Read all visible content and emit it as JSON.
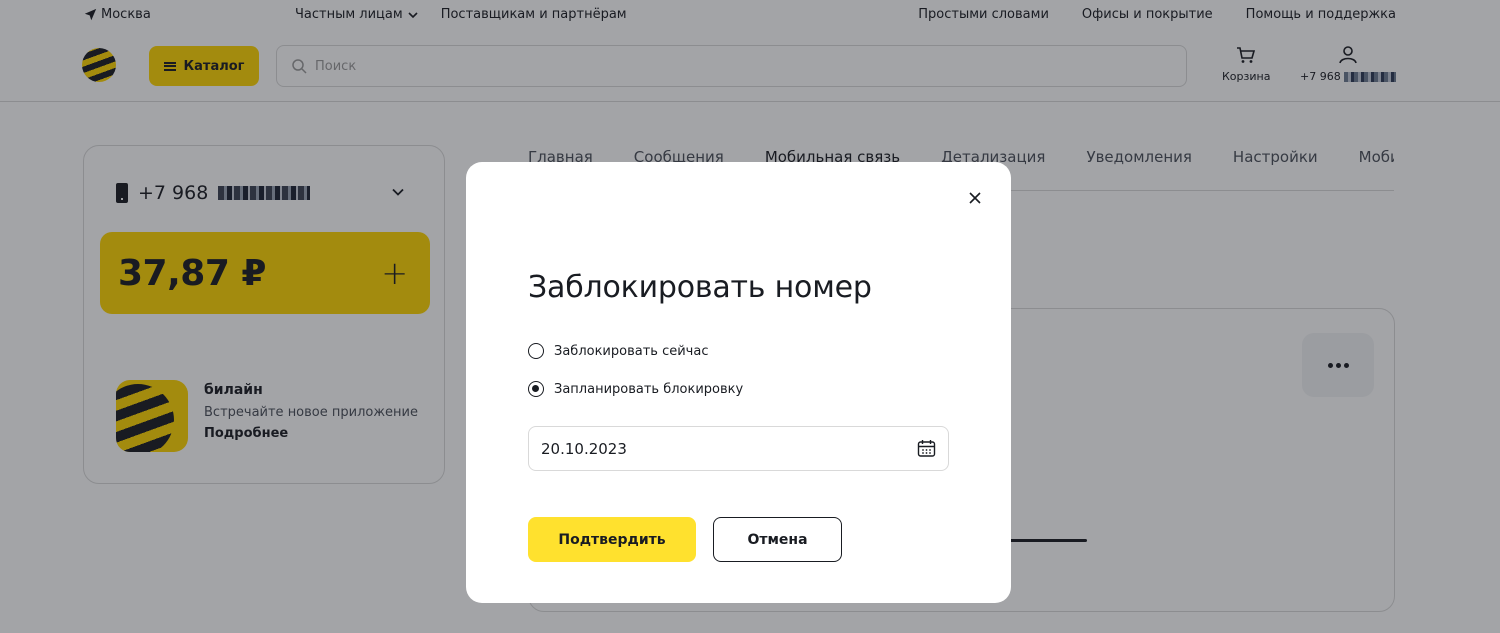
{
  "topbar": {
    "city": "Москва",
    "nav_left": [
      "Частным лицам",
      "Поставщикам и партнёрам"
    ],
    "nav_right": [
      "Простыми словами",
      "Офисы и покрытие",
      "Помощь и поддержка"
    ]
  },
  "header": {
    "catalog_label": "Каталог",
    "search_placeholder": "Поиск",
    "cart_label": "Корзина",
    "profile_phone_prefix": "+7 968"
  },
  "account": {
    "phone_prefix": "+7 968",
    "balance": "37,87 ₽"
  },
  "promo": {
    "title": "билайн",
    "subtitle": "Встречайте новое приложение",
    "link": "Подробнее"
  },
  "tabs": [
    "Главная",
    "Сообщения",
    "Мобильная связь",
    "Детализация",
    "Уведомления",
    "Настройки",
    "Мобильный ID"
  ],
  "active_tab_index": 2,
  "modal": {
    "title": "Заблокировать номер",
    "options": [
      {
        "label": "Заблокировать сейчас",
        "checked": false
      },
      {
        "label": "Запланировать блокировку",
        "checked": true
      }
    ],
    "date_value": "20.10.2023",
    "confirm_label": "Подтвердить",
    "cancel_label": "Отмена"
  },
  "colors": {
    "brand_yellow": "#ffd500",
    "button_yellow": "#ffe12e",
    "text_dark": "#191c22",
    "overlay": "rgba(25,28,34,0.4)"
  }
}
